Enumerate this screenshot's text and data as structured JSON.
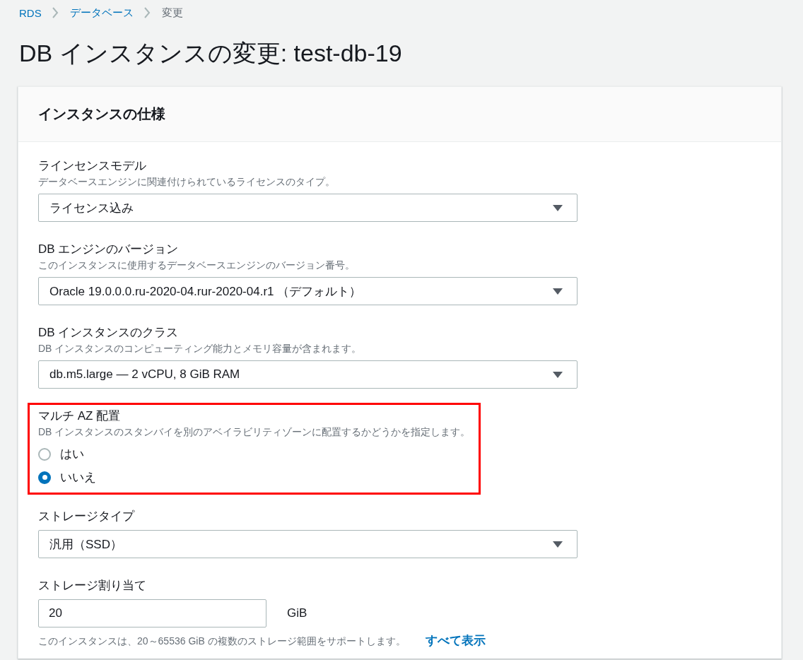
{
  "breadcrumb": [
    {
      "label": "RDS",
      "link": true
    },
    {
      "label": "データベース",
      "link": true
    },
    {
      "label": "変更",
      "link": false
    }
  ],
  "page_title": "DB インスタンスの変更: test-db-19",
  "panel": {
    "title": "インスタンスの仕様",
    "fields": [
      {
        "kind": "select",
        "label": "ラインセンスモデル",
        "description": "データベースエンジンに関連付けられているライセンスのタイプ。",
        "value": "ライセンス込み",
        "highlighted": false
      },
      {
        "kind": "select",
        "label": "DB エンジンのバージョン",
        "description": "このインスタンスに使用するデータベースエンジンのバージョン番号。",
        "value": "Oracle 19.0.0.0.ru-2020-04.rur-2020-04.r1 （デフォルト）",
        "highlighted": false
      },
      {
        "kind": "select",
        "label": "DB インスタンスのクラス",
        "description": "DB インスタンスのコンピューティング能力とメモリ容量が含まれます。",
        "value": "db.m5.large — 2 vCPU, 8 GiB RAM",
        "highlighted": false
      },
      {
        "kind": "radio",
        "label": "マルチ AZ 配置",
        "description": "DB インスタンスのスタンバイを別のアベイラビリティゾーンに配置するかどうかを指定します。",
        "highlighted": true,
        "options": [
          {
            "label": "はい",
            "selected": false
          },
          {
            "label": "いいえ",
            "selected": true
          }
        ]
      },
      {
        "kind": "select",
        "label": "ストレージタイプ",
        "value": "汎用（SSD）",
        "highlighted": false
      },
      {
        "kind": "number",
        "label": "ストレージ割り当て",
        "value": "20",
        "unit": "GiB",
        "help": "このインスタンスは、20～65536 GiB の複数のストレージ範囲をサポートします。",
        "link": "すべて表示",
        "highlighted": false
      }
    ]
  }
}
